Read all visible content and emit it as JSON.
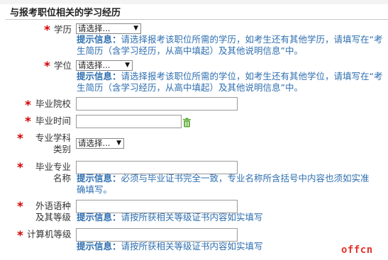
{
  "section": {
    "title": "与报考职位相关的学习经历"
  },
  "required_mark": "*",
  "fields": {
    "education": {
      "label": "学历",
      "select_value": "请选择...",
      "hint_prefix": "提示信息：",
      "hint_text": "请选择报考该职位所需的学历，如考生还有其他学历，请填写在“考生简历（含学习经历，从高中填起）及其他说明信息”中。"
    },
    "degree": {
      "label": "学位",
      "select_value": "请选择...",
      "hint_prefix": "提示信息：",
      "hint_text": "请选择报考该职位所需的学位，如考生还有其他学位，请填写在“考生简历（含学习经历，从高中填起）及其他说明信息”中。"
    },
    "school": {
      "label": "毕业院校",
      "value": ""
    },
    "grad_time": {
      "label": "毕业时间",
      "value": ""
    },
    "major_category": {
      "label": "专业学科类别",
      "select_value": "请选择..."
    },
    "major_name": {
      "label": "毕业专业名称",
      "value": "",
      "hint_prefix": "提示信息：",
      "hint_text": "必须与毕业证书完全一致，专业名称所含括号中内容也须如实准确填写。"
    },
    "foreign_lang": {
      "label": "外语语种及其等级",
      "value": "",
      "hint_prefix": "提示信息：",
      "hint_text": "请按所获相关等级证书内容如实填写"
    },
    "computer": {
      "label": "计算机等级",
      "value": "",
      "hint_prefix": "提示信息：",
      "hint_text": "请按所获相关等级证书内容如实填写"
    }
  },
  "icons": {
    "clear_date": "trash-icon",
    "dropdown": "chevron-down-icon"
  },
  "watermark": "offcn"
}
